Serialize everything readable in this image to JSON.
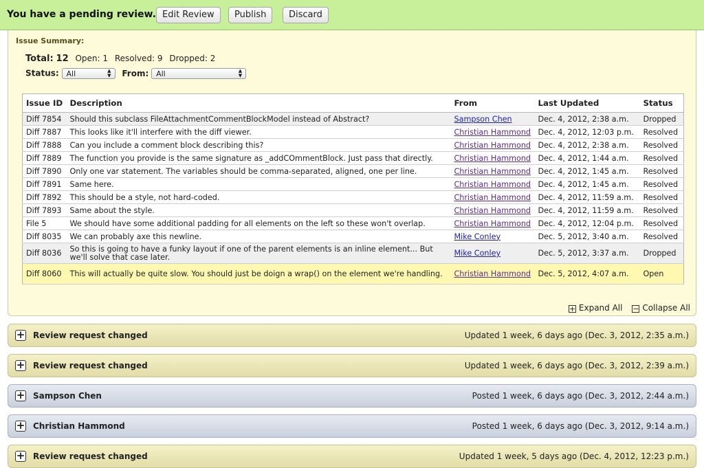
{
  "banner": {
    "title": "You have a pending review.",
    "buttons": {
      "edit": "Edit Review",
      "publish": "Publish",
      "discard": "Discard"
    }
  },
  "summary": {
    "heading": "Issue Summary:",
    "total_label": "Total:",
    "total": "12",
    "open": "Open: 1",
    "resolved": "Resolved: 9",
    "dropped": "Dropped: 2",
    "status_label": "Status:",
    "status_value": "All",
    "from_label": "From:",
    "from_value": "All"
  },
  "table": {
    "headers": {
      "id": "Issue ID",
      "description": "Description",
      "from": "From",
      "updated": "Last Updated",
      "status": "Status"
    },
    "rows": [
      {
        "id": "Diff 7854",
        "description": "Should this subclass FileAttachmentCommentBlockModel instead of Abstract?",
        "from": "Sampson Chen",
        "updated": "Dec. 4, 2012, 2:38 a.m.",
        "status": "Dropped"
      },
      {
        "id": "Diff 7887",
        "description": "This looks like it'll interfere with the diff viewer.",
        "from": "Christian Hammond",
        "updated": "Dec. 4, 2012, 12:03 p.m.",
        "status": "Resolved"
      },
      {
        "id": "Diff 7888",
        "description": "Can you include a comment block describing this?",
        "from": "Christian Hammond",
        "updated": "Dec. 4, 2012, 2:38 a.m.",
        "status": "Resolved"
      },
      {
        "id": "Diff 7889",
        "description": "The function you provide is the same signature as _addCOmmentBlock. Just pass that directly.",
        "from": "Christian Hammond",
        "updated": "Dec. 4, 2012, 1:44 a.m.",
        "status": "Resolved"
      },
      {
        "id": "Diff 7890",
        "description": "Only one var statement. The variables should be comma-separated, aligned, one per line.",
        "from": "Christian Hammond",
        "updated": "Dec. 4, 2012, 1:45 a.m.",
        "status": "Resolved"
      },
      {
        "id": "Diff 7891",
        "description": "Same here.",
        "from": "Christian Hammond",
        "updated": "Dec. 4, 2012, 1:45 a.m.",
        "status": "Resolved"
      },
      {
        "id": "Diff 7892",
        "description": "This should be a style, not hard-coded.",
        "from": "Christian Hammond",
        "updated": "Dec. 4, 2012, 11:59 a.m.",
        "status": "Resolved"
      },
      {
        "id": "Diff 7893",
        "description": "Same about the style.",
        "from": "Christian Hammond",
        "updated": "Dec. 4, 2012, 11:59 a.m.",
        "status": "Resolved"
      },
      {
        "id": "File 5",
        "description": "We should have some additional padding for all elements on the left so these won't overlap.",
        "from": "Christian Hammond",
        "updated": "Dec. 4, 2012, 12:04 p.m.",
        "status": "Resolved"
      },
      {
        "id": "Diff 8035",
        "description": "We can probably axe this newline.",
        "from": "Mike Conley",
        "updated": "Dec. 5, 2012, 3:40 a.m.",
        "status": "Resolved"
      },
      {
        "id": "Diff 8036",
        "description": "So this is going to have a funky layout if one of the parent elements is an inline element... But we'll solve that case later.",
        "from": "Mike Conley",
        "updated": "Dec. 5, 2012, 3:37 a.m.",
        "status": "Dropped"
      },
      {
        "id": "Diff 8060",
        "description": "This will actually be quite slow. You should just be doign a wrap() on the element we're handling.",
        "from": "Christian Hammond",
        "updated": "Dec. 5, 2012, 4:07 a.m.",
        "status": "Open"
      }
    ]
  },
  "controls": {
    "expand_all": "Expand All",
    "collapse_all": "Collapse All"
  },
  "boxes": [
    {
      "title": "Review request changed",
      "time": "Updated 1 week, 6 days ago (Dec. 3, 2012, 2:35 a.m.)",
      "kind": "change"
    },
    {
      "title": "Review request changed",
      "time": "Updated 1 week, 6 days ago (Dec. 3, 2012, 2:39 a.m.)",
      "kind": "change"
    },
    {
      "title": "Sampson Chen",
      "time": "Posted 1 week, 6 days ago (Dec. 3, 2012, 2:44 a.m.)",
      "kind": "review"
    },
    {
      "title": "Christian Hammond",
      "time": "Posted 1 week, 6 days ago (Dec. 3, 2012, 9:14 a.m.)",
      "kind": "review"
    },
    {
      "title": "Review request changed",
      "time": "Updated 1 week, 5 days ago (Dec. 4, 2012, 12:23 p.m.)",
      "kind": "change"
    }
  ]
}
